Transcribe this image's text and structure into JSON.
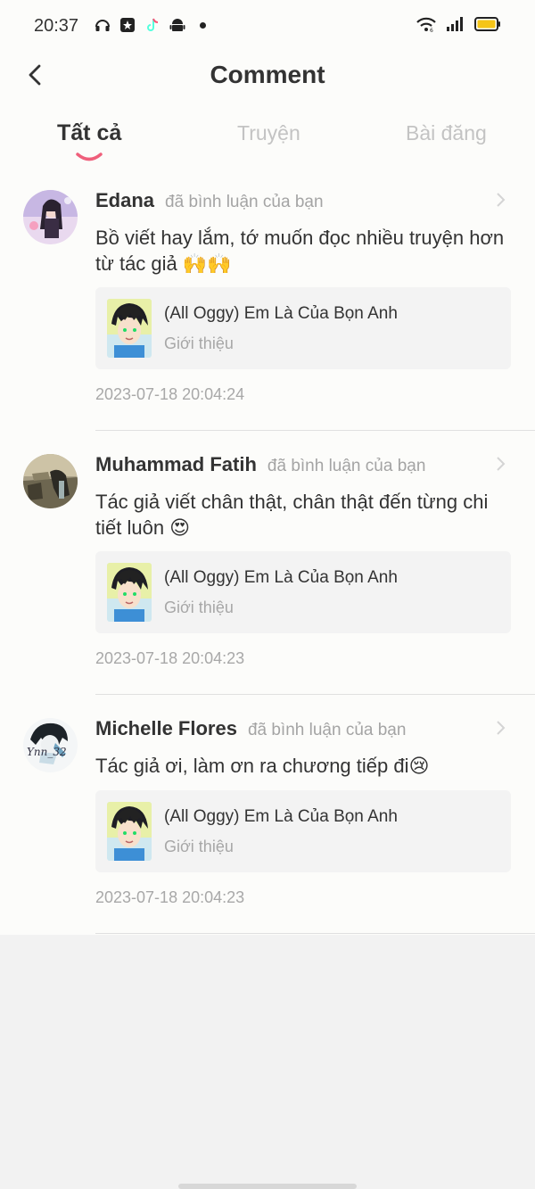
{
  "status_bar": {
    "time": "20:37",
    "left_icons": [
      "headset-icon",
      "star-app-icon",
      "tiktok-icon",
      "android-icon",
      "dot-icon"
    ],
    "right_icons": [
      "wifi-icon",
      "signal-icon",
      "battery-icon"
    ],
    "battery_color": "#f5c518"
  },
  "header": {
    "title": "Comment",
    "tabs": [
      {
        "label": "Tất cả",
        "active": true
      },
      {
        "label": "Truyện",
        "active": false
      },
      {
        "label": "Bài đăng",
        "active": false
      }
    ],
    "accent": "#ef5f7b"
  },
  "comments": [
    {
      "name": "Edana",
      "action": "đã bình luận của bạn",
      "text": "Bồ viết hay lắm, tớ muốn đọc nhiều truyện hơn từ tác giả 🙌🙌",
      "card_title": "(All Oggy) Em Là Của Bọn Anh",
      "card_sub": "Giới thiệu",
      "timestamp": "2023-07-18 20:04:24"
    },
    {
      "name": "Muhammad Fatih",
      "action": "đã bình luận của bạn",
      "text": "Tác giả viết chân thật, chân thật đến từng chi tiết luôn 😍",
      "card_title": "(All Oggy) Em Là Của Bọn Anh",
      "card_sub": "Giới thiệu",
      "timestamp": "2023-07-18 20:04:23"
    },
    {
      "name": "Michelle Flores",
      "action": "đã bình luận của bạn",
      "text": "Tác giả ơi, làm ơn ra chương tiếp đi😢",
      "card_title": "(All Oggy) Em Là Của Bọn Anh",
      "card_sub": "Giới thiệu",
      "timestamp": "2023-07-18 20:04:23",
      "avatar_text": "Ynn_32"
    }
  ]
}
